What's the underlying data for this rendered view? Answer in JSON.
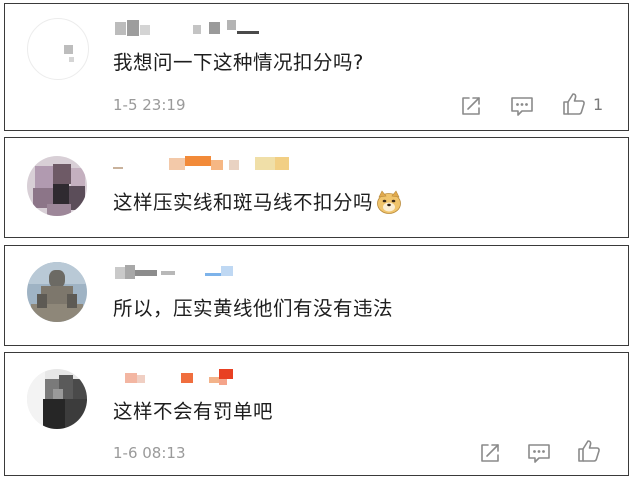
{
  "comments": [
    {
      "text": "我想问一下这种情况扣分吗?",
      "time": "1-5 23:19",
      "like_count": "1",
      "share_icon": "share-icon",
      "reply_icon": "comment-icon",
      "like_icon": "thumbs-up-icon"
    },
    {
      "text": "这样压实线和斑马线不扣分吗",
      "emoji": "doge-face-emoji"
    },
    {
      "text": "所以，压实黄线他们有没有违法"
    },
    {
      "text": "这样不会有罚单吧",
      "time": "1-6 08:13",
      "share_icon": "share-icon",
      "reply_icon": "comment-icon",
      "like_icon": "thumbs-up-icon"
    }
  ],
  "colors": {
    "card_border": "#3a3a3a",
    "text": "#1d1d1d",
    "meta": "#9a9a9a",
    "icon": "#8a8a8a"
  }
}
